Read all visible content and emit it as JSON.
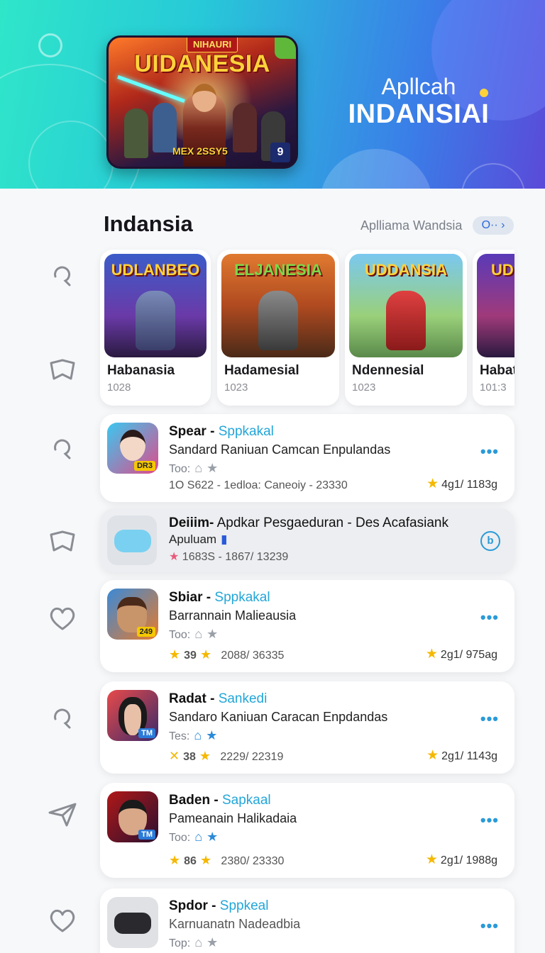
{
  "hero": {
    "banner_tag": "NIHAURI",
    "banner_title": "UIDANESIA",
    "banner_sub": "MEX 2SSY5",
    "banner_num": "9",
    "title_line1": "Apllcah",
    "title_line2": "INDANSIAI"
  },
  "section": {
    "title": "Indansia",
    "see_all": "Aplliama Wandsia",
    "see_all_pill": "O·· ›"
  },
  "featured": [
    {
      "art_title": "UDLANBEO",
      "name": "Habanasia",
      "count": "1028"
    },
    {
      "art_title": "ELJANESIA",
      "name": "Hadamesial",
      "count": "1023"
    },
    {
      "art_title": "UDDANSIA",
      "name": "Ndennesial",
      "count": "1023"
    },
    {
      "art_title": "UDI",
      "name": "Habat",
      "count": "101:3"
    }
  ],
  "list": [
    {
      "title": "Spear - ",
      "accent": "Sppkakal",
      "desc": "Sandard Raniuan Camcan Enpulandas",
      "meta": "Too:",
      "stats": "1O S622 - 1edloa: Caneoiy - 23330",
      "right": "4g1/ 1183g",
      "badge": "DR3"
    },
    {
      "title": "Deiiim-",
      "accent": "",
      "desc_inline": " Apdkar Pesgaeduran - Des Acafasiank",
      "desc": "Apuluam",
      "stats": "1683S - 1867/ 13239",
      "btn": "b"
    },
    {
      "title": "Sbiar - ",
      "accent": "Sppkakal",
      "desc": "Barrannain Malieausia",
      "meta": "Too:",
      "stats_left": "39",
      "stats": "2088/ 36335",
      "right": "2g1/ 975ag",
      "badge": "249"
    },
    {
      "title": "Radat - ",
      "accent": "Sankedi",
      "desc": "Sandaro Kaniuan Caracan Enpdandas",
      "meta": "Tes:",
      "stats_left": "38",
      "stats": "2229/ 22319",
      "right": "2g1/ 1143g",
      "badge": "TM"
    },
    {
      "title": "Baden - ",
      "accent": "Sapkaal",
      "desc": "Pameanain Halikadaia",
      "meta": "Too:",
      "stats_left": "86",
      "stats": "2380/ 23330",
      "right": "2g1/ 1988g",
      "badge": "TM"
    },
    {
      "title": "Spdor - ",
      "accent": "Sppkeal",
      "desc": "Karnuanatn Nadeadbia",
      "meta": "Top:"
    }
  ],
  "colors": {
    "accent": "#22a6d8",
    "star": "#f5b800"
  }
}
